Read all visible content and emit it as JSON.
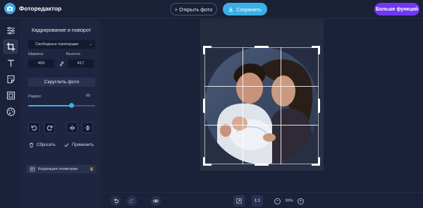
{
  "app": {
    "title": "Фоторедактор"
  },
  "header": {
    "open_label": "Открыть фото",
    "open_prefix": "+",
    "save_label": "Сохранить",
    "more_label": "Больше функций"
  },
  "rail": {
    "items": [
      {
        "icon": "sliders-icon",
        "active": false
      },
      {
        "icon": "crop-icon",
        "active": true
      },
      {
        "icon": "text-icon",
        "active": false
      },
      {
        "icon": "sticker-icon",
        "active": false
      },
      {
        "icon": "frame-icon",
        "active": false
      },
      {
        "icon": "palette-icon",
        "active": false
      }
    ]
  },
  "panel": {
    "title": "Кадрирование и поворот",
    "ratio_select": "Свободные пропорции",
    "width_label": "Ширина:",
    "height_label": "Высота:",
    "width_value": "403",
    "height_value": "417",
    "round_button": "Скруглить фото",
    "radius_label": "Радиус",
    "radius_value": "65",
    "radius_fraction": 0.65,
    "reset_label": "Сбросить",
    "apply_label": "Применить",
    "geometry_label": "Коррекция геометрии"
  },
  "bottom": {
    "ratio_label": "1:1",
    "zoom_value": "30%"
  },
  "colors": {
    "accent": "#3ab0e6",
    "premium": "#7038f0",
    "background": "#1b2138"
  }
}
